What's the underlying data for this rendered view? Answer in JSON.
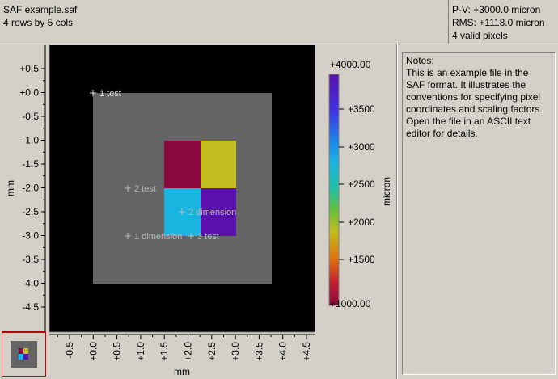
{
  "header": {
    "filename": "SAF example.saf",
    "dimensions": "4 rows by 5 cols",
    "pv": "P-V: +3000.0 micron",
    "rms": "RMS: +1118.0 micron",
    "valid_pixels": "4 valid pixels"
  },
  "plot": {
    "y_axis_label": "mm",
    "x_axis_label": "mm",
    "y_ticks": [
      "+0.5",
      "+0.0",
      "-0.5",
      "-1.0",
      "-1.5",
      "-2.0",
      "-2.5",
      "-3.0",
      "-3.5",
      "-4.0",
      "-4.5"
    ],
    "x_ticks": [
      "-0.5",
      "+0.0",
      "+0.5",
      "+1.0",
      "+1.5",
      "+2.0",
      "+2.5",
      "+3.0",
      "+3.5",
      "+4.0",
      "+4.5"
    ],
    "markers": [
      {
        "label": "1 test"
      },
      {
        "label": "2 test"
      },
      {
        "label": "1 dimension"
      },
      {
        "label": "2 dimension"
      },
      {
        "label": "3 test"
      }
    ],
    "cell_colors": [
      "#8b0b40",
      "#c2bc1e",
      "#1ab4e0",
      "#5a10ac"
    ],
    "background_color": "#000000",
    "area_color": "#646464"
  },
  "colorbar": {
    "label": "micron",
    "ticks": [
      "+4000.00",
      "+3500",
      "+3000",
      "+2500",
      "+2000",
      "+1500",
      "+1000.00"
    ]
  },
  "notes": {
    "title": "Notes:",
    "text": "This is an example file in the SAF format. It illustrates the conventions for specifying pixel coordinates and scaling factors. Open the file in an ASCII text editor for details."
  }
}
